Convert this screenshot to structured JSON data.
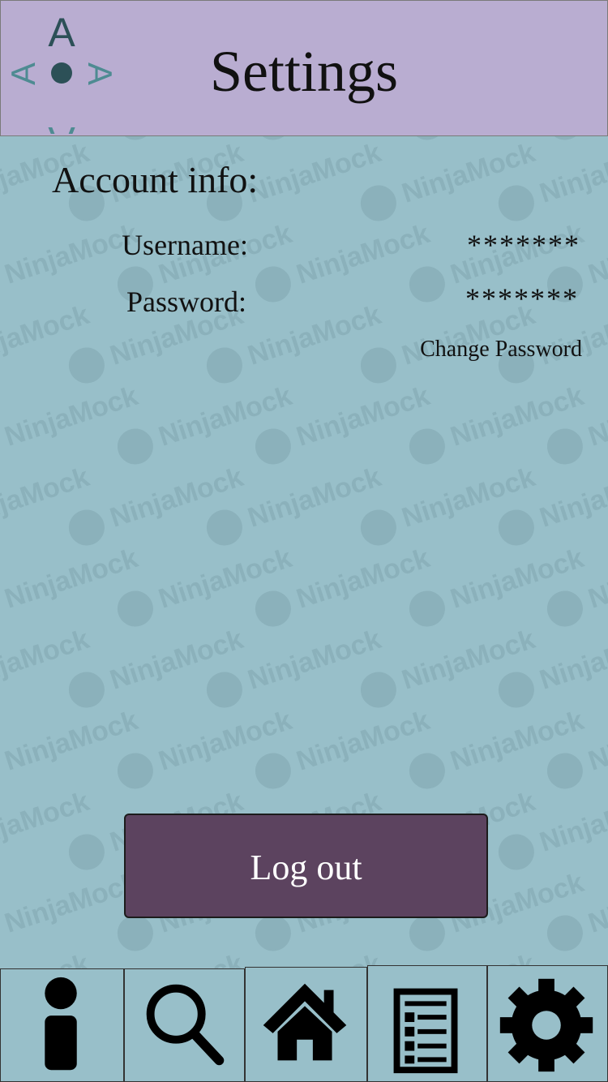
{
  "header": {
    "title": "Settings",
    "logo_icon": "compass-logo-icon",
    "logo_letters": [
      "A",
      "A",
      "A",
      "A"
    ]
  },
  "account": {
    "section_title": "Account info:",
    "username_label": "Username:",
    "username_value": "*******",
    "password_label": "Password:",
    "password_value": "*******",
    "change_password_label": "Change Password"
  },
  "actions": {
    "logout_label": "Log out"
  },
  "tabbar": {
    "items": [
      {
        "icon": "info-icon"
      },
      {
        "icon": "search-icon"
      },
      {
        "icon": "home-icon"
      },
      {
        "icon": "list-icon"
      },
      {
        "icon": "gear-icon"
      }
    ]
  },
  "watermark_text": "NinjaMock",
  "colors": {
    "background": "#98bfc9",
    "header": "#b9add1",
    "logout_button": "#5c435f",
    "logo_teal": "#4e8b92",
    "logo_dark": "#2c5057"
  }
}
